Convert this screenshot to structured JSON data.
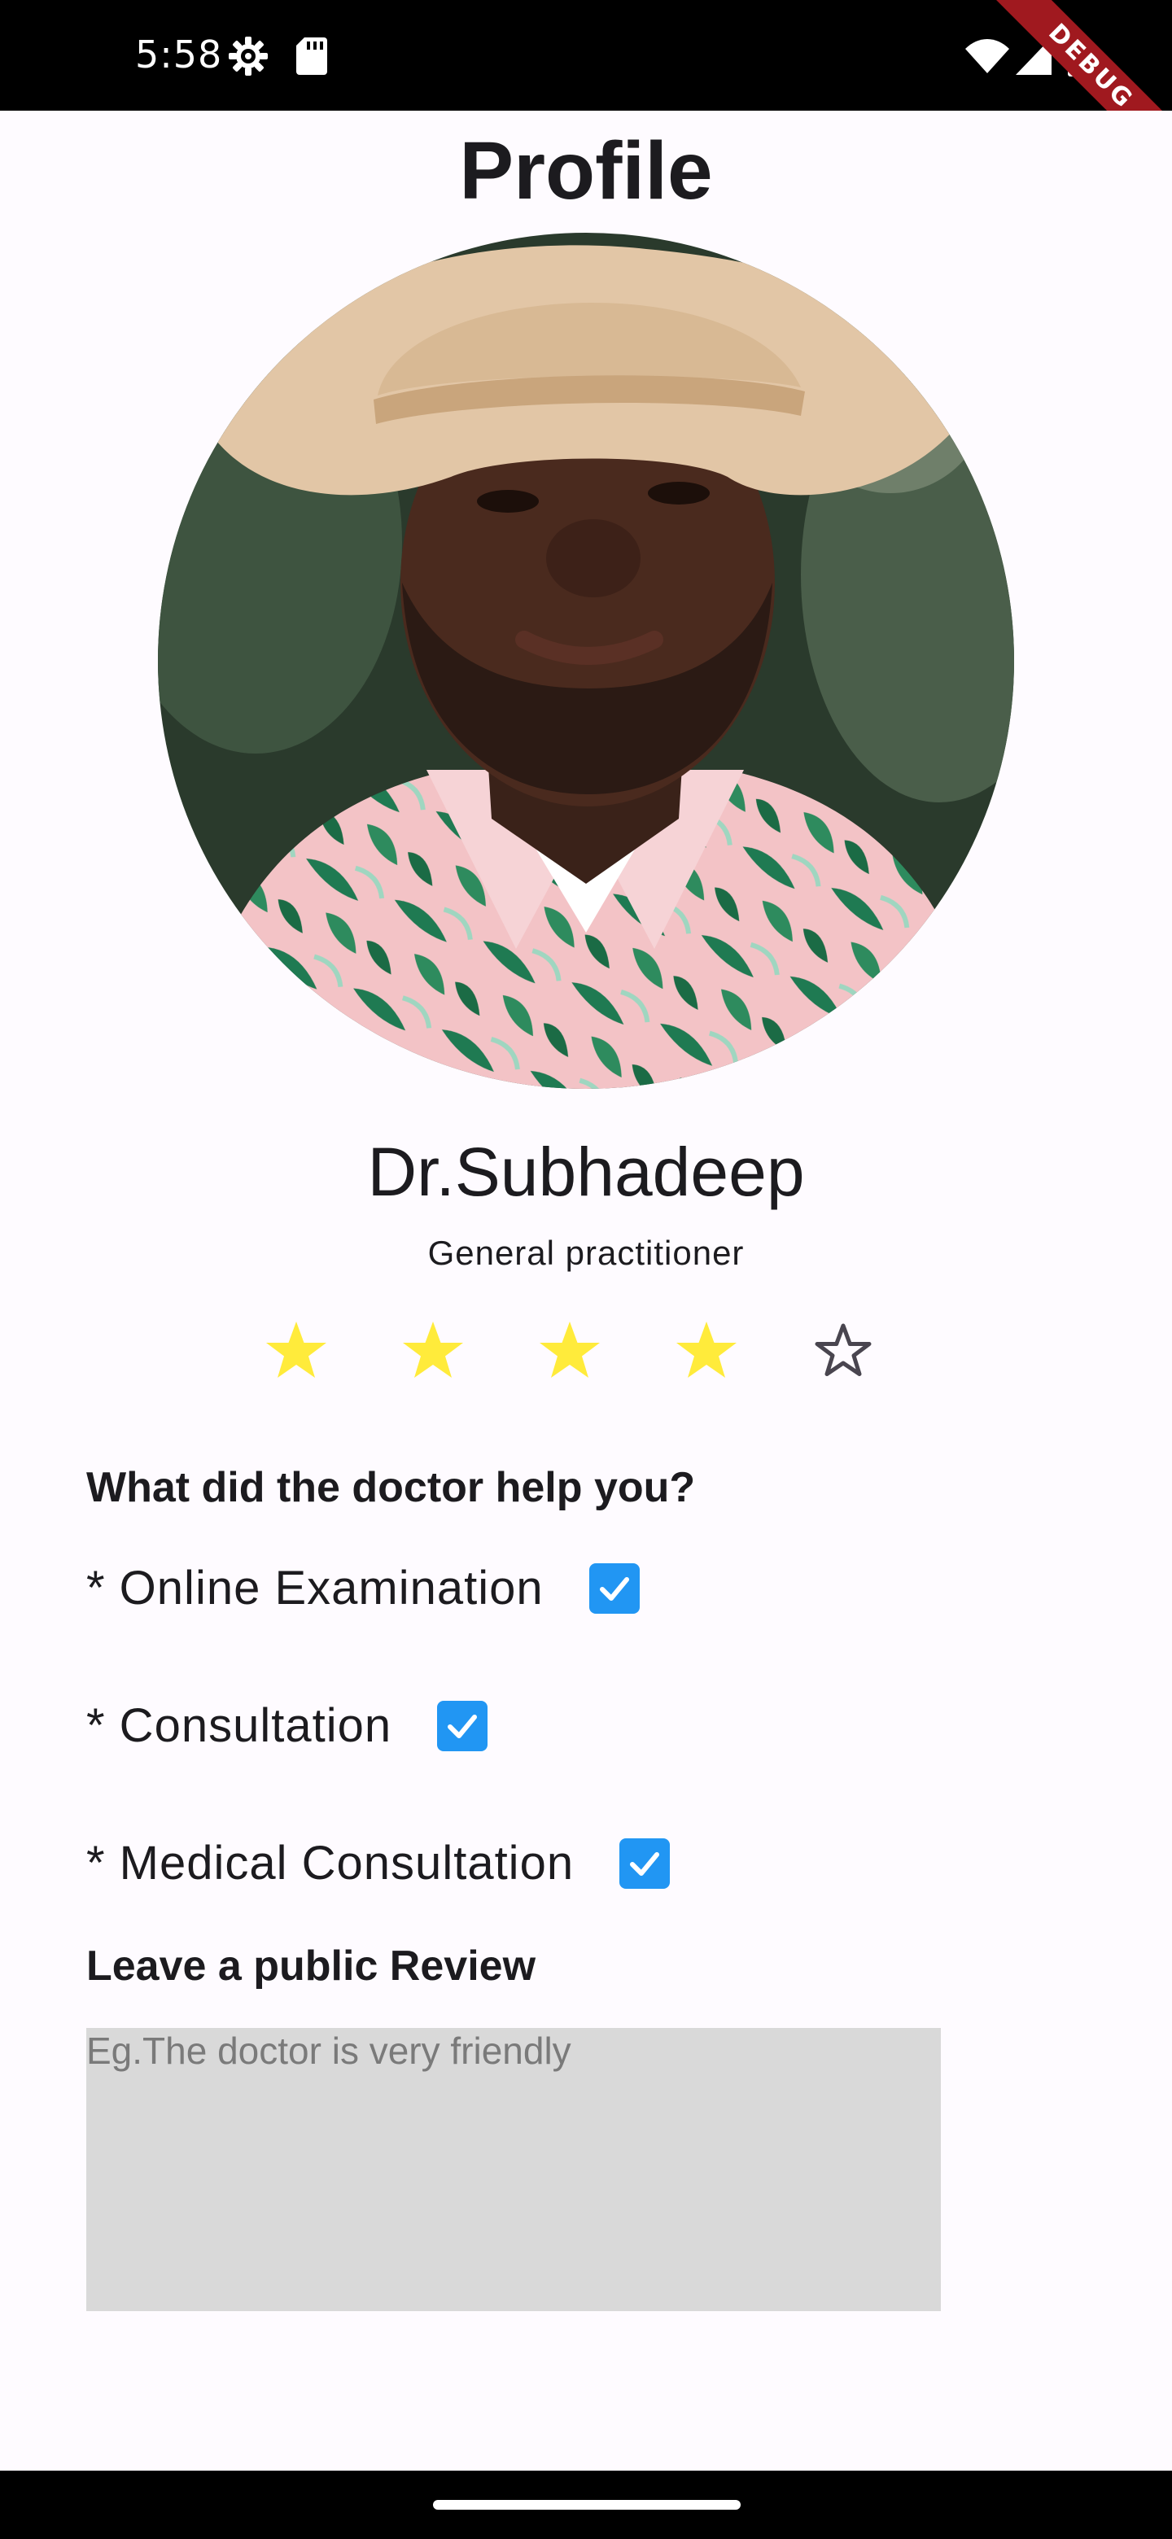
{
  "status_bar": {
    "time": "5:58",
    "debug_label": "DEBUG",
    "icons": [
      "gear-icon",
      "sd-card-icon",
      "wifi-icon",
      "signal-icon",
      "battery-icon"
    ]
  },
  "page": {
    "title": "Profile"
  },
  "doctor": {
    "name": "Dr.Subhadeep",
    "specialty": "General practitioner"
  },
  "rating": {
    "value": 4,
    "max": 5,
    "filled_color": "#ffeb3b",
    "empty_outline_color": "#49454f"
  },
  "help_section": {
    "heading": "What did the doctor help you?",
    "options": [
      {
        "label": "* Online Examination",
        "checked": true
      },
      {
        "label": "* Consultation",
        "checked": true
      },
      {
        "label": "* Medical Consultation",
        "checked": true
      }
    ],
    "checkbox_color": "#2196f3"
  },
  "review_section": {
    "heading": "Leave a public Review",
    "value": "",
    "placeholder": "Eg.The doctor is very friendly"
  },
  "colors": {
    "background": "#fefbff",
    "review_box": "#d9d9d9",
    "debug_ribbon": "#a0191f"
  }
}
